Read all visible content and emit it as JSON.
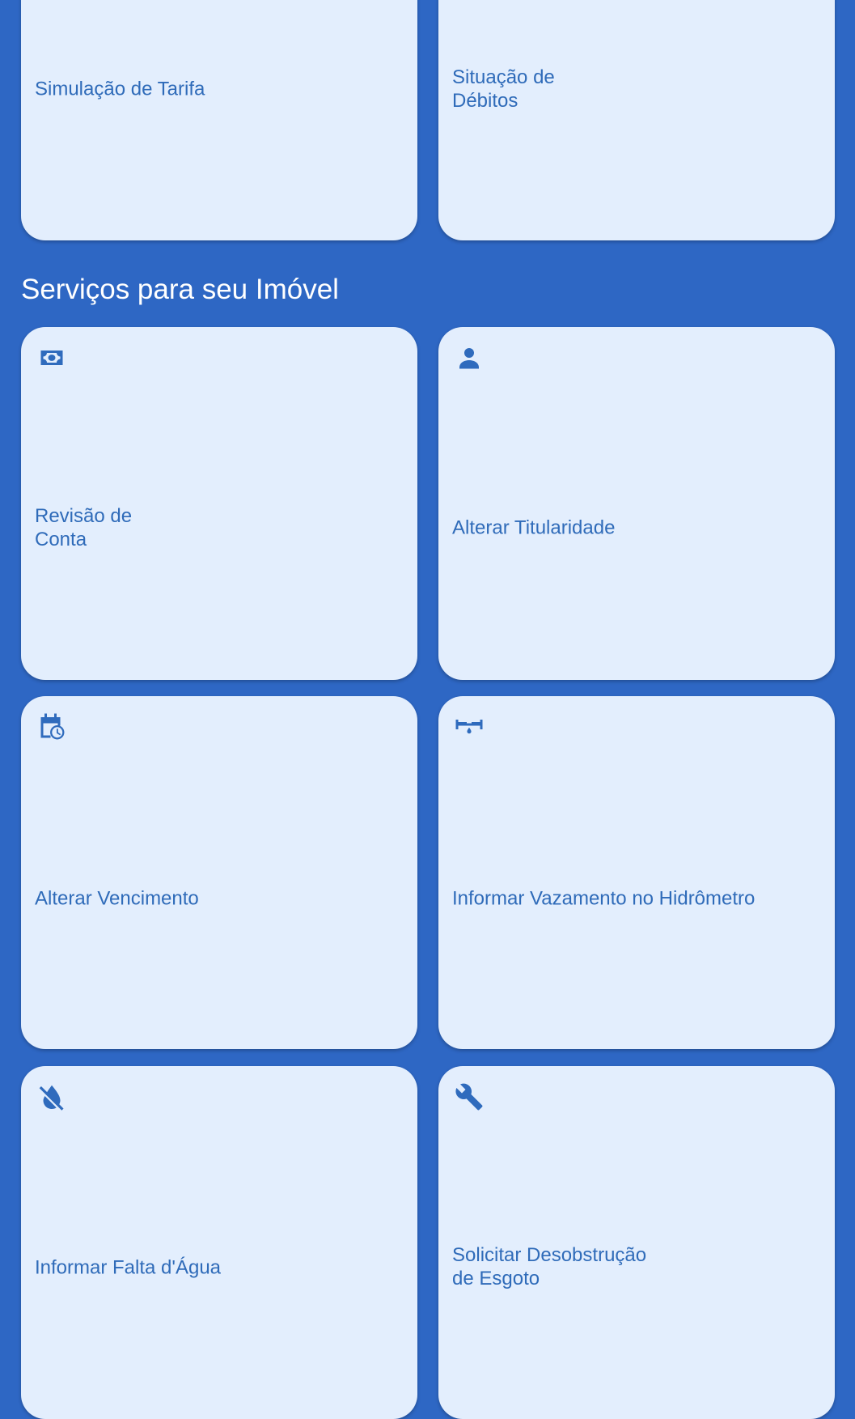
{
  "top_cards": [
    {
      "label": "Simulação de Tarifa"
    },
    {
      "label": "Situação de\nDébitos"
    }
  ],
  "section": {
    "title": "Serviços para seu Imóvel"
  },
  "service_cards": [
    {
      "label": "Revisão de\nConta",
      "icon": "cash-icon"
    },
    {
      "label": "Alterar Titularidade",
      "icon": "person-icon"
    },
    {
      "label": "Alterar Vencimento",
      "icon": "calendar-clock-icon"
    },
    {
      "label": "Informar Vazamento no Hidrômetro",
      "icon": "pipe-leak-icon"
    },
    {
      "label": "Informar Falta d'Água",
      "icon": "water-off-icon"
    },
    {
      "label": "Solicitar Desobstrução\nde Esgoto",
      "icon": "wrench-icon"
    }
  ],
  "colors": {
    "background": "#2e67c4",
    "card": "#e3eefd",
    "card_text": "#2f6bb9",
    "section_title": "#ffffff"
  }
}
